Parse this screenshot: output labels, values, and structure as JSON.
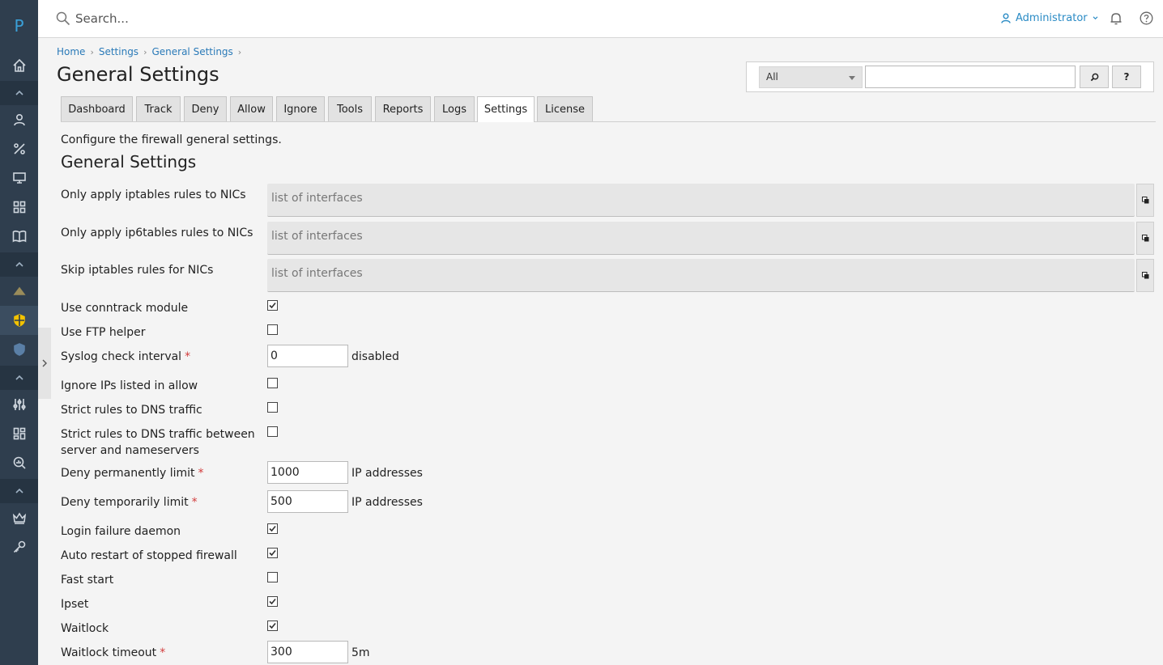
{
  "sidebar": {
    "logo": "P"
  },
  "topbar": {
    "search_placeholder": "Search...",
    "user_name": "Administrator"
  },
  "breadcrumb": [
    "Home",
    "Settings",
    "General Settings"
  ],
  "page_title": "General Settings",
  "filter": {
    "select_value": "All",
    "search_btn_icon": "search-icon",
    "help_label": "?"
  },
  "tabs": [
    "Dashboard",
    "Track",
    "Deny",
    "Allow",
    "Ignore",
    "Tools",
    "Reports",
    "Logs",
    "Settings",
    "License"
  ],
  "active_tab": "Settings",
  "description": "Configure the firewall general settings.",
  "section_title": "General Settings",
  "fields": {
    "iptables_nics": {
      "label": "Only apply iptables rules to NICs",
      "placeholder": "list of interfaces"
    },
    "ip6tables_nics": {
      "label": "Only apply ip6tables rules to NICs",
      "placeholder": "list of interfaces"
    },
    "skip_nics": {
      "label": "Skip iptables rules for NICs",
      "placeholder": "list of interfaces"
    },
    "conntrack": {
      "label": "Use conntrack module",
      "checked": true
    },
    "ftp_helper": {
      "label": "Use FTP helper",
      "checked": false
    },
    "syslog_interval": {
      "label": "Syslog check interval",
      "value": "0",
      "unit": "disabled"
    },
    "ignore_allow": {
      "label": "Ignore IPs listed in allow",
      "checked": false
    },
    "strict_dns": {
      "label": "Strict rules to DNS traffic",
      "checked": false
    },
    "strict_dns_ns": {
      "label_line1": "Strict rules to DNS traffic between",
      "label_line2": "server and nameservers",
      "checked": false
    },
    "deny_perm": {
      "label": "Deny permanently limit",
      "value": "1000",
      "unit": "IP addresses"
    },
    "deny_temp": {
      "label": "Deny temporarily limit",
      "value": "500",
      "unit": "IP addresses"
    },
    "lfd": {
      "label": "Login failure daemon",
      "checked": true
    },
    "auto_restart": {
      "label": "Auto restart of stopped firewall",
      "checked": true
    },
    "fast_start": {
      "label": "Fast start",
      "checked": false
    },
    "ipset": {
      "label": "Ipset",
      "checked": true
    },
    "waitlock": {
      "label": "Waitlock",
      "checked": true
    },
    "waitlock_timeout": {
      "label": "Waitlock timeout",
      "value": "300",
      "unit": "5m"
    }
  },
  "required_mark": "*"
}
